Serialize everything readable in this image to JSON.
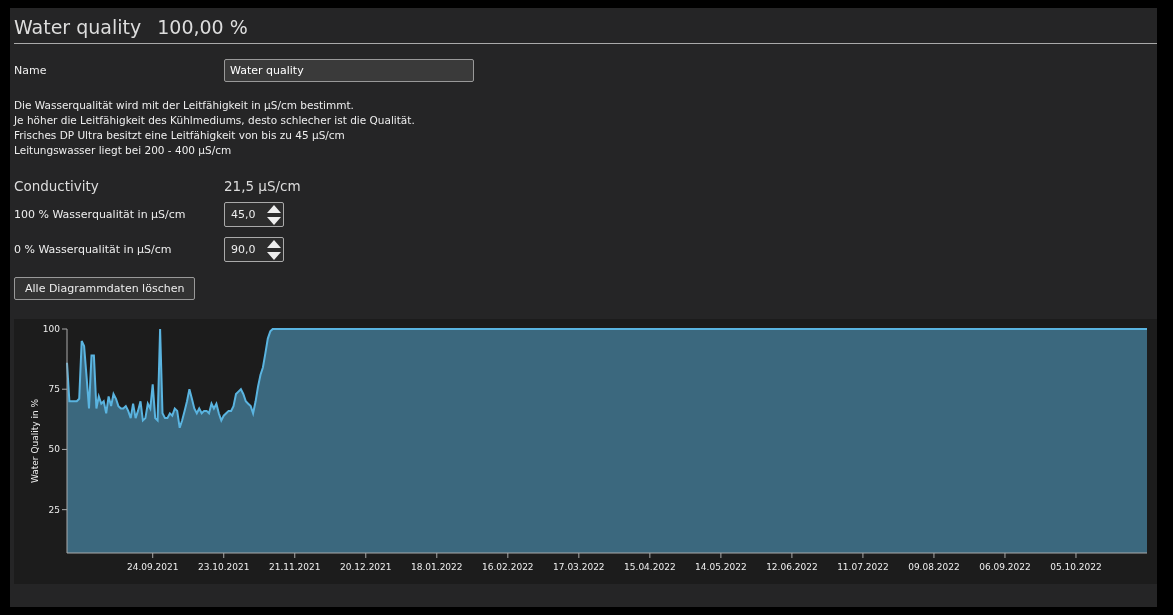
{
  "header": {
    "title": "Water quality",
    "value": "100,00 %"
  },
  "name_field": {
    "label": "Name",
    "value": "Water quality"
  },
  "description_lines": [
    "Die Wasserqualität wird mit der Leitfähigkeit in µS/cm bestimmt.",
    "Je höher die Leitfähigkeit des Kühlmediums, desto schlecher ist die Qualität.",
    "Frisches DP Ultra besitzt eine Leitfähigkeit von bis zu 45 µS/cm",
    "Leitungswasser liegt bei 200 - 400 µS/cm"
  ],
  "conductivity": {
    "label": "Conductivity",
    "value": "21,5 µS/cm"
  },
  "spin_fields": [
    {
      "label": "100 % Wasserqualität in µS/cm",
      "value": "45,0"
    },
    {
      "label": "0 % Wasserqualität in µS/cm",
      "value": "90,0"
    }
  ],
  "clear_button": "Alle Diagrammdaten löschen",
  "chart": {
    "chart_data": {
      "type": "area",
      "ylabel": "Water Quality in %",
      "ylim": [
        7,
        100
      ],
      "yticks": [
        25,
        50,
        75,
        100
      ],
      "categories": [
        null,
        null,
        null,
        null,
        null,
        null,
        null,
        null,
        null,
        null,
        null,
        null,
        null,
        null,
        null,
        null,
        null,
        null,
        null,
        null,
        null,
        null,
        null,
        null,
        null,
        null,
        null,
        null,
        null,
        null,
        null,
        null,
        null,
        null,
        null,
        "24.09.2021",
        null,
        null,
        null,
        null,
        null,
        null,
        null,
        null,
        null,
        null,
        null,
        null,
        null,
        null,
        null,
        null,
        null,
        null,
        null,
        null,
        null,
        null,
        null,
        null,
        null,
        null,
        null,
        null,
        "23.10.2021",
        null,
        null,
        null,
        null,
        null,
        null,
        null,
        null,
        null,
        null,
        null,
        null,
        null,
        null,
        null,
        null,
        null,
        null,
        null,
        null,
        null,
        null,
        null,
        null,
        null,
        null,
        null,
        null,
        "21.11.2021",
        null,
        null,
        null,
        null,
        null,
        null,
        null,
        null,
        null,
        null,
        null,
        null,
        null,
        null,
        null,
        null,
        null,
        null,
        null,
        null,
        null,
        null,
        null,
        null,
        null,
        null,
        null,
        null,
        "20.12.2021",
        null,
        null,
        null,
        null,
        null,
        null,
        null,
        null,
        null,
        null,
        null,
        null,
        null,
        null,
        null,
        null,
        null,
        null,
        null,
        null,
        null,
        null,
        null,
        null,
        null,
        null,
        null,
        null,
        "18.01.2022",
        null,
        null,
        null,
        null,
        null,
        null,
        null,
        null,
        null,
        null,
        null,
        null,
        null,
        null,
        null,
        null,
        null,
        null,
        null,
        null,
        null,
        null,
        null,
        null,
        null,
        null,
        null,
        null,
        "16.02.2022",
        null,
        null,
        null,
        null,
        null,
        null,
        null,
        null,
        null,
        null,
        null,
        null,
        null,
        null,
        null,
        null,
        null,
        null,
        null,
        null,
        null,
        null,
        null,
        null,
        null,
        null,
        null,
        null,
        "17.03.2022",
        null,
        null,
        null,
        null,
        null,
        null,
        null,
        null,
        null,
        null,
        null,
        null,
        null,
        null,
        null,
        null,
        null,
        null,
        null,
        null,
        null,
        null,
        null,
        null,
        null,
        null,
        null,
        null,
        "15.04.2022",
        null,
        null,
        null,
        null,
        null,
        null,
        null,
        null,
        null,
        null,
        null,
        null,
        null,
        null,
        null,
        null,
        null,
        null,
        null,
        null,
        null,
        null,
        null,
        null,
        null,
        null,
        null,
        null,
        "14.05.2022",
        null,
        null,
        null,
        null,
        null,
        null,
        null,
        null,
        null,
        null,
        null,
        null,
        null,
        null,
        null,
        null,
        null,
        null,
        null,
        null,
        null,
        null,
        null,
        null,
        null,
        null,
        null,
        null,
        "12.06.2022",
        null,
        null,
        null,
        null,
        null,
        null,
        null,
        null,
        null,
        null,
        null,
        null,
        null,
        null,
        null,
        null,
        null,
        null,
        null,
        null,
        null,
        null,
        null,
        null,
        null,
        null,
        null,
        null,
        "11.07.2022",
        null,
        null,
        null,
        null,
        null,
        null,
        null,
        null,
        null,
        null,
        null,
        null,
        null,
        null,
        null,
        null,
        null,
        null,
        null,
        null,
        null,
        null,
        null,
        null,
        null,
        null,
        null,
        null,
        "09.08.2022",
        null,
        null,
        null,
        null,
        null,
        null,
        null,
        null,
        null,
        null,
        null,
        null,
        null,
        null,
        null,
        null,
        null,
        null,
        null,
        null,
        null,
        null,
        null,
        null,
        null,
        null,
        null,
        null,
        "06.09.2022",
        null,
        null,
        null,
        null,
        null,
        null,
        null,
        null,
        null,
        null,
        null,
        null,
        null,
        null,
        null,
        null,
        null,
        null,
        null,
        null,
        null,
        null,
        null,
        null,
        null,
        null,
        null,
        null,
        "05.10.2022",
        null,
        null,
        null,
        null,
        null,
        null,
        null,
        null,
        null,
        null,
        null,
        null,
        null,
        null,
        null,
        null,
        null,
        null,
        null,
        null,
        null,
        null,
        null,
        null,
        null,
        null,
        null,
        null,
        null
      ],
      "series": [
        {
          "color": "#5ab4e0",
          "values": [
            86,
            70,
            70,
            70,
            70,
            71,
            95,
            93,
            80,
            67,
            89,
            89,
            67,
            72,
            69,
            70,
            65,
            72,
            68,
            73,
            71,
            68,
            67,
            67,
            68,
            66,
            63,
            69,
            63,
            66,
            70,
            62,
            63,
            69,
            67,
            77,
            63,
            62,
            100,
            65,
            63,
            63,
            65,
            64,
            67,
            66,
            59,
            62,
            66,
            70,
            75,
            71,
            67,
            65,
            67,
            65,
            66,
            66,
            65,
            69,
            67,
            69,
            65,
            62,
            64,
            65,
            66,
            66,
            68,
            73,
            74,
            75,
            73,
            70,
            69,
            68,
            65,
            70,
            76,
            81,
            84,
            90,
            96,
            99,
            100,
            100,
            100,
            100,
            100,
            100,
            100,
            100,
            100,
            100,
            100,
            100,
            100,
            100,
            100,
            100,
            100,
            100,
            100,
            100,
            100,
            100,
            100,
            100,
            100,
            100,
            100,
            100,
            100,
            100,
            100,
            100,
            100,
            100,
            100,
            100,
            100,
            100,
            100,
            100,
            100,
            100,
            100,
            100,
            100,
            100,
            100,
            100,
            100,
            100,
            100,
            100,
            100,
            100,
            100,
            100,
            100,
            100,
            100,
            100,
            100,
            100,
            100,
            100,
            100,
            100,
            100,
            100,
            100,
            100,
            100,
            100,
            100,
            100,
            100,
            100,
            100,
            100,
            100,
            100,
            100,
            100,
            100,
            100,
            100,
            100,
            100,
            100,
            100,
            100,
            100,
            100,
            100,
            100,
            100,
            100,
            100,
            100,
            100,
            100,
            100,
            100,
            100,
            100,
            100,
            100,
            100,
            100,
            100,
            100,
            100,
            100,
            100,
            100,
            100,
            100,
            100,
            100,
            100,
            100,
            100,
            100,
            100,
            100,
            100,
            100,
            100,
            100,
            100,
            100,
            100,
            100,
            100,
            100,
            100,
            100,
            100,
            100,
            100,
            100,
            100,
            100,
            100,
            100,
            100,
            100,
            100,
            100,
            100,
            100,
            100,
            100,
            100,
            100,
            100,
            100,
            100,
            100,
            100,
            100,
            100,
            100,
            100,
            100,
            100,
            100,
            100,
            100,
            100,
            100,
            100,
            100,
            100,
            100,
            100,
            100,
            100,
            100,
            100,
            100,
            100,
            100,
            100,
            100,
            100,
            100,
            100,
            100,
            100,
            100,
            100,
            100,
            100,
            100,
            100,
            100,
            100,
            100,
            100,
            100,
            100,
            100,
            100,
            100,
            100,
            100,
            100,
            100,
            100,
            100,
            100,
            100,
            100,
            100,
            100,
            100,
            100,
            100,
            100,
            100,
            100,
            100,
            100,
            100,
            100,
            100,
            100,
            100,
            100,
            100,
            100,
            100,
            100,
            100,
            100,
            100,
            100,
            100,
            100,
            100,
            100,
            100,
            100,
            100,
            100,
            100,
            100,
            100,
            100,
            100,
            100,
            100,
            100,
            100,
            100,
            100,
            100,
            100,
            100,
            100,
            100,
            100,
            100,
            100,
            100,
            100,
            100,
            100,
            100,
            100,
            100,
            100,
            100,
            100,
            100,
            100,
            100,
            100,
            100,
            100,
            100,
            100,
            100,
            100,
            100,
            100,
            100,
            100,
            100,
            100,
            100,
            100,
            100,
            100,
            100,
            100,
            100,
            100,
            100,
            100,
            100,
            100,
            100,
            100,
            100,
            100,
            100,
            100,
            100,
            100,
            100,
            100,
            100,
            100,
            100,
            100,
            100,
            100,
            100,
            100,
            100,
            100,
            100,
            100,
            100,
            100,
            100,
            100,
            100,
            100,
            100,
            100,
            100,
            100,
            100,
            100,
            100,
            100,
            100,
            100,
            100,
            100,
            100,
            100,
            100,
            100,
            100,
            100,
            100,
            100,
            100,
            100,
            100,
            100,
            100,
            100,
            100,
            100
          ]
        }
      ]
    }
  }
}
